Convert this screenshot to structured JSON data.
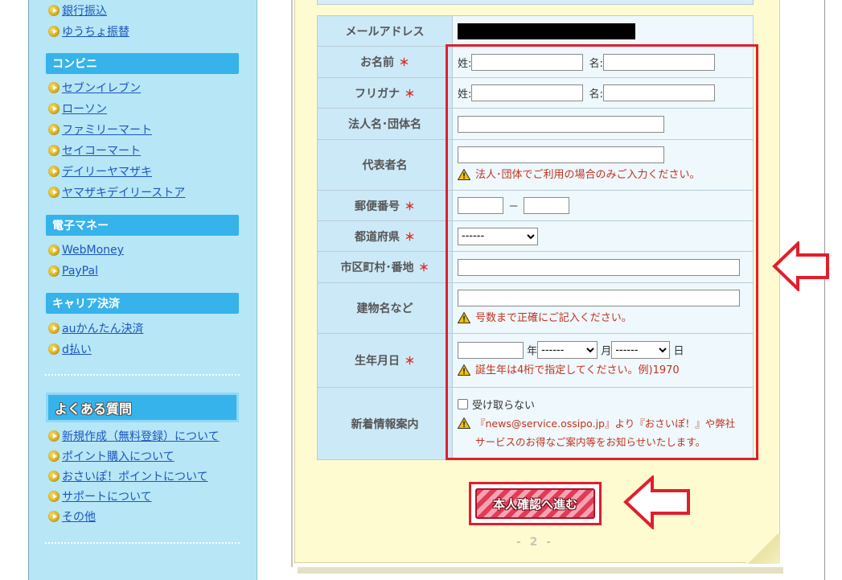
{
  "sidebar": {
    "payment_links_top": [
      "銀行振込",
      "ゆうちょ振替"
    ],
    "sections": [
      {
        "title": "コンビニ",
        "items": [
          "セブンイレブン",
          "ローソン",
          "ファミリーマート",
          "セイコーマート",
          "デイリーヤマザキ",
          "ヤマザキデイリーストア"
        ]
      },
      {
        "title": "電子マネー",
        "items": [
          "WebMoney",
          "PayPal"
        ]
      },
      {
        "title": "キャリア決済",
        "items": [
          "auかんたん決済",
          "d払い"
        ]
      }
    ],
    "faq": {
      "title": "よくある質問",
      "items": [
        "新規作成（無料登録）について",
        "ポイント購入について",
        "おさいぽ！ポイントについて",
        "サポートについて",
        "その他"
      ]
    }
  },
  "form": {
    "email_label": "メールアドレス",
    "name_label": "お名前",
    "furigana_label": "フリガナ",
    "sei": "姓:",
    "mei": "名:",
    "required_mark": "＊",
    "company_label": "法人名･団体名",
    "representative_label": "代表者名",
    "representative_note": "法人･団体でご利用の場合のみご入力ください。",
    "postal_label": "郵便番号",
    "postal_sep": "－",
    "pref_label": "都道府県",
    "pref_default": "------",
    "city_label": "市区町村･番地",
    "building_label": "建物名など",
    "building_note": "号数まで正確にご記入ください。",
    "birth_label": "生年月日",
    "year_unit": "年",
    "month_unit": "月",
    "day_unit": "日",
    "birth_month_default": "------",
    "birth_day_default": "------",
    "birth_note": "誕生年は4桁で指定してください。例)1970",
    "newsletter_label": "新着情報案内",
    "newsletter_checkbox": "受け取らない",
    "newsletter_note_line1": "『news@service.ossipo.jp』より『おさいぽ！』や弊社",
    "newsletter_note_line2": "サービスのお得なご案内等をお知らせいたします。"
  },
  "submit": {
    "label": "本人確認へ進む"
  },
  "page_number": "- 2 -",
  "colors": {
    "accent_red": "#e21e2c",
    "sidebar_bg": "#b7e6f6",
    "sidebar_head": "#36b3ea",
    "paper_bg": "#fffbd0",
    "link": "#1a57c2"
  }
}
